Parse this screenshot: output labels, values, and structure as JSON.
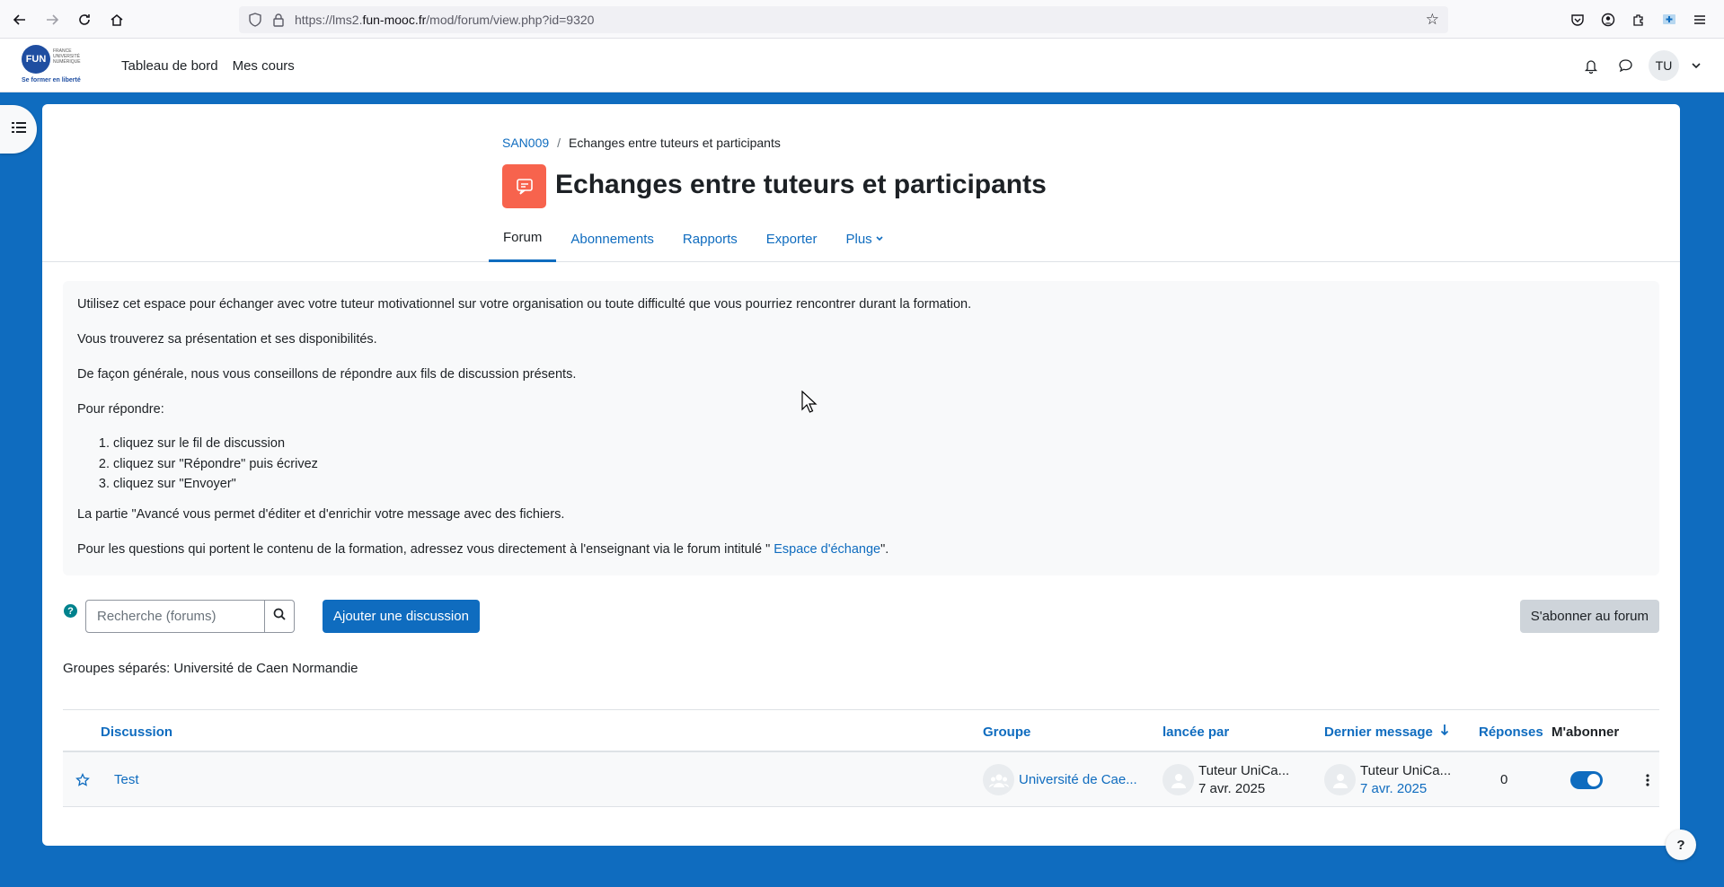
{
  "browser": {
    "url_prefix": "https://lms2.",
    "url_domain": "fun-mooc.fr",
    "url_suffix": "/mod/forum/view.php?id=9320"
  },
  "logo": {
    "mark": "FUN",
    "small_text": "FRANCE UNIVERSITÉ NUMÉRIQUE",
    "tagline": "Se former en liberté"
  },
  "navbar": {
    "items": [
      "Tableau de bord",
      "Mes cours"
    ],
    "user_initials": "TU"
  },
  "breadcrumb": {
    "course": "SAN009",
    "separator": "/",
    "current": "Echanges entre tuteurs et participants"
  },
  "page": {
    "title": "Echanges entre tuteurs et participants"
  },
  "tabs": [
    {
      "label": "Forum",
      "active": true
    },
    {
      "label": "Abonnements"
    },
    {
      "label": "Rapports"
    },
    {
      "label": "Exporter"
    },
    {
      "label": "Plus"
    }
  ],
  "intro": {
    "p1": "Utilisez cet espace pour échanger avec votre tuteur motivationnel sur votre organisation ou toute difficulté que vous pourriez rencontrer durant la formation.",
    "p2": "Vous trouverez sa présentation et ses disponibilités.",
    "p3": "De façon générale, nous vous conseillons de répondre aux fils de discussion présents.",
    "p4": "Pour répondre:",
    "steps": [
      "cliquez sur le fil de discussion",
      "cliquez sur \"Répondre\" puis écrivez",
      "cliquez sur \"Envoyer\""
    ],
    "p5": "La partie \"Avancé vous permet d'éditer et d'enrichir votre message avec des fichiers.",
    "p6_before": "Pour les questions qui portent le contenu de la formation, adressez vous directement à l'enseignant via le forum intitulé \" ",
    "p6_link": "Espace d'échange",
    "p6_after": "\"."
  },
  "controls": {
    "help": "?",
    "search_placeholder": "Recherche (forums)",
    "add_discussion": "Ajouter une discussion",
    "subscribe_forum": "S'abonner au forum",
    "groups_label": "Groupes séparés: Université de Caen Normandie"
  },
  "table": {
    "headers": {
      "discussion": "Discussion",
      "group": "Groupe",
      "started_by": "lancée par",
      "last_post": "Dernier message",
      "replies": "Réponses",
      "subscribe": "M'abonner"
    },
    "rows": [
      {
        "title": "Test",
        "group": "Université de Cae...",
        "author": "Tuteur UniCa...",
        "author_date": "7 avr. 2025",
        "last_author": "Tuteur UniCa...",
        "last_date": "7 avr. 2025",
        "replies": "0",
        "subscribed": true
      }
    ]
  },
  "colors": {
    "brand": "#0f6cbf",
    "forum_icon": "#f7634d"
  }
}
